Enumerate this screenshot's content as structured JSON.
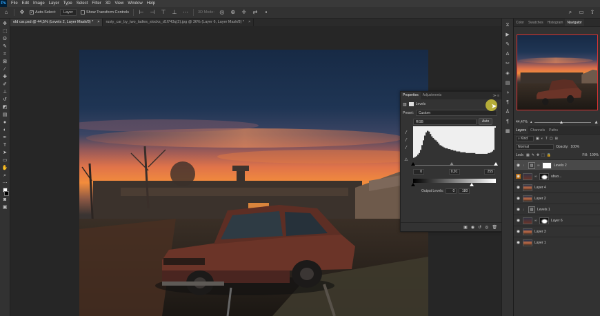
{
  "app": {
    "logo": "Ps"
  },
  "menu": [
    "File",
    "Edit",
    "Image",
    "Layer",
    "Type",
    "Select",
    "Filter",
    "3D",
    "View",
    "Window",
    "Help"
  ],
  "options": {
    "auto_select_label": "Auto-Select:",
    "auto_select_value": "Layer",
    "transform_label": "Show Transform Controls",
    "mode_label": "3D Mode:"
  },
  "tabs": [
    {
      "title": "old car.psd @ 44,5% (Levels 2, Layer Mask/8) *",
      "active": true
    },
    {
      "title": "rusty_car_by_two_ladies_stocks_d1f743q(2).jpg @ 36% (Layer 6, Layer Mask/8) *",
      "active": false
    }
  ],
  "right_tabs": [
    "Color",
    "Swatches",
    "Histogram",
    "Navigator"
  ],
  "navigator": {
    "zoom": "44,47%"
  },
  "layers_tabs": [
    "Layers",
    "Channels",
    "Paths"
  ],
  "layers_panel": {
    "kind": "Kind",
    "blend_mode": "Normal",
    "opacity_label": "Opacity:",
    "opacity": "100%",
    "lock_label": "Lock:",
    "fill_label": "Fill:",
    "fill": "100%",
    "layers": [
      {
        "name": "Levels 2",
        "type": "adjustment",
        "selected": true,
        "mask": "white",
        "visible": true,
        "clip": true
      },
      {
        "name": "ubuo...",
        "type": "image-mask",
        "visible": true,
        "highlight": true,
        "mask": "dark"
      },
      {
        "name": "Layer 4",
        "type": "pixel",
        "visible": true
      },
      {
        "name": "Layer 2",
        "type": "pixel",
        "visible": true
      },
      {
        "name": "Levels 1",
        "type": "adjustment",
        "visible": true,
        "mask": "none",
        "clip": true
      },
      {
        "name": "Layer 6",
        "type": "image-mask",
        "visible": true,
        "mask": "dark"
      },
      {
        "name": "Layer 3",
        "type": "pixel",
        "visible": true
      },
      {
        "name": "Layer 1",
        "type": "pixel",
        "visible": true
      }
    ]
  },
  "properties": {
    "tabs": [
      "Properties",
      "Adjustments"
    ],
    "header": "Levels",
    "preset_label": "Preset:",
    "preset_value": "Custom",
    "channel": "RGB",
    "auto_button": "Auto",
    "input_black": "0",
    "input_gamma": "0,91",
    "input_white": "255",
    "output_label": "Output Levels:",
    "output_black": "0",
    "output_white": "180",
    "histogram": [
      2,
      3,
      4,
      6,
      8,
      12,
      18,
      24,
      30,
      34,
      36,
      35,
      32,
      29,
      27,
      25,
      24,
      22,
      20,
      18,
      17,
      16,
      15,
      14,
      14,
      13,
      13,
      12,
      12,
      11,
      11,
      10,
      10,
      10,
      9,
      9,
      9,
      9,
      8,
      8,
      8,
      8,
      8,
      8,
      8,
      7,
      7,
      7,
      7,
      7,
      7,
      7,
      7,
      7,
      8,
      8,
      9,
      10,
      12,
      40
    ]
  }
}
